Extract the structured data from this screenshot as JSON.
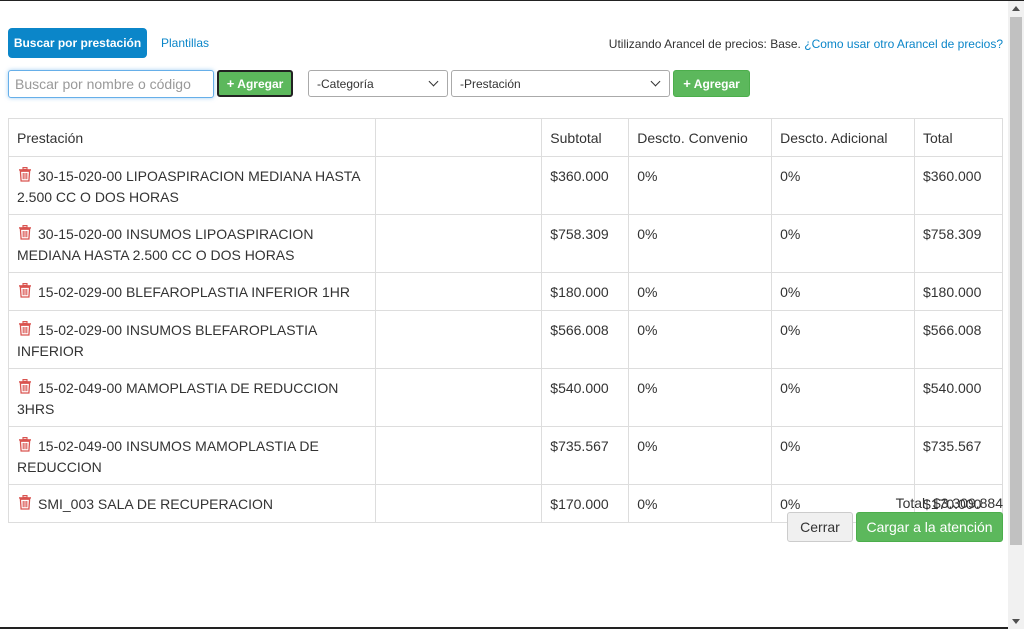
{
  "tabs": {
    "search_by_service": "Buscar por prestación",
    "templates": "Plantillas"
  },
  "arancel": {
    "prefix": "Utilizando Arancel de precios: Base.",
    "help_link": "¿Como usar otro Arancel de precios?"
  },
  "search": {
    "placeholder": "Buscar por nombre o código",
    "value": "",
    "add_label": "Agregar"
  },
  "filters": {
    "category_selected": "-Categoría",
    "service_selected": "-Prestación",
    "add_label": "Agregar"
  },
  "table": {
    "headers": [
      "Prestación",
      "",
      "Subtotal",
      "Descto. Convenio",
      "Descto. Adicional",
      "Total"
    ],
    "rows": [
      {
        "name": "30-15-020-00 LIPOASPIRACION MEDIANA HASTA 2.500 CC O DOS HORAS",
        "subtotal": "$360.000",
        "convenio": "0%",
        "adicional": "0%",
        "total": "$360.000"
      },
      {
        "name": "30-15-020-00 INSUMOS LIPOASPIRACION MEDIANA HASTA 2.500 CC O DOS HORAS",
        "subtotal": "$758.309",
        "convenio": "0%",
        "adicional": "0%",
        "total": "$758.309"
      },
      {
        "name": "15-02-029-00 BLEFAROPLASTIA INFERIOR 1HR",
        "subtotal": "$180.000",
        "convenio": "0%",
        "adicional": "0%",
        "total": "$180.000"
      },
      {
        "name": "15-02-029-00 INSUMOS BLEFAROPLASTIA INFERIOR",
        "subtotal": "$566.008",
        "convenio": "0%",
        "adicional": "0%",
        "total": "$566.008"
      },
      {
        "name": "15-02-049-00 MAMOPLASTIA DE REDUCCION 3HRS",
        "subtotal": "$540.000",
        "convenio": "0%",
        "adicional": "0%",
        "total": "$540.000"
      },
      {
        "name": "15-02-049-00 INSUMOS MAMOPLASTIA DE REDUCCION",
        "subtotal": "$735.567",
        "convenio": "0%",
        "adicional": "0%",
        "total": "$735.567"
      },
      {
        "name": "SMI_003 SALA DE RECUPERACION",
        "subtotal": "$170.000",
        "convenio": "0%",
        "adicional": "0%",
        "total": "$170.000"
      }
    ]
  },
  "footer": {
    "total": "Total: $3.309.884",
    "close_label": "Cerrar",
    "submit_label": "Cargar a la atención"
  },
  "colors": {
    "primary": "#0b86c9",
    "success": "#5cb85c",
    "trash": "#d9534f"
  },
  "icons": {
    "row_delete": "trash-icon",
    "add": "plus-icon",
    "select": "chevron-down-icon"
  }
}
